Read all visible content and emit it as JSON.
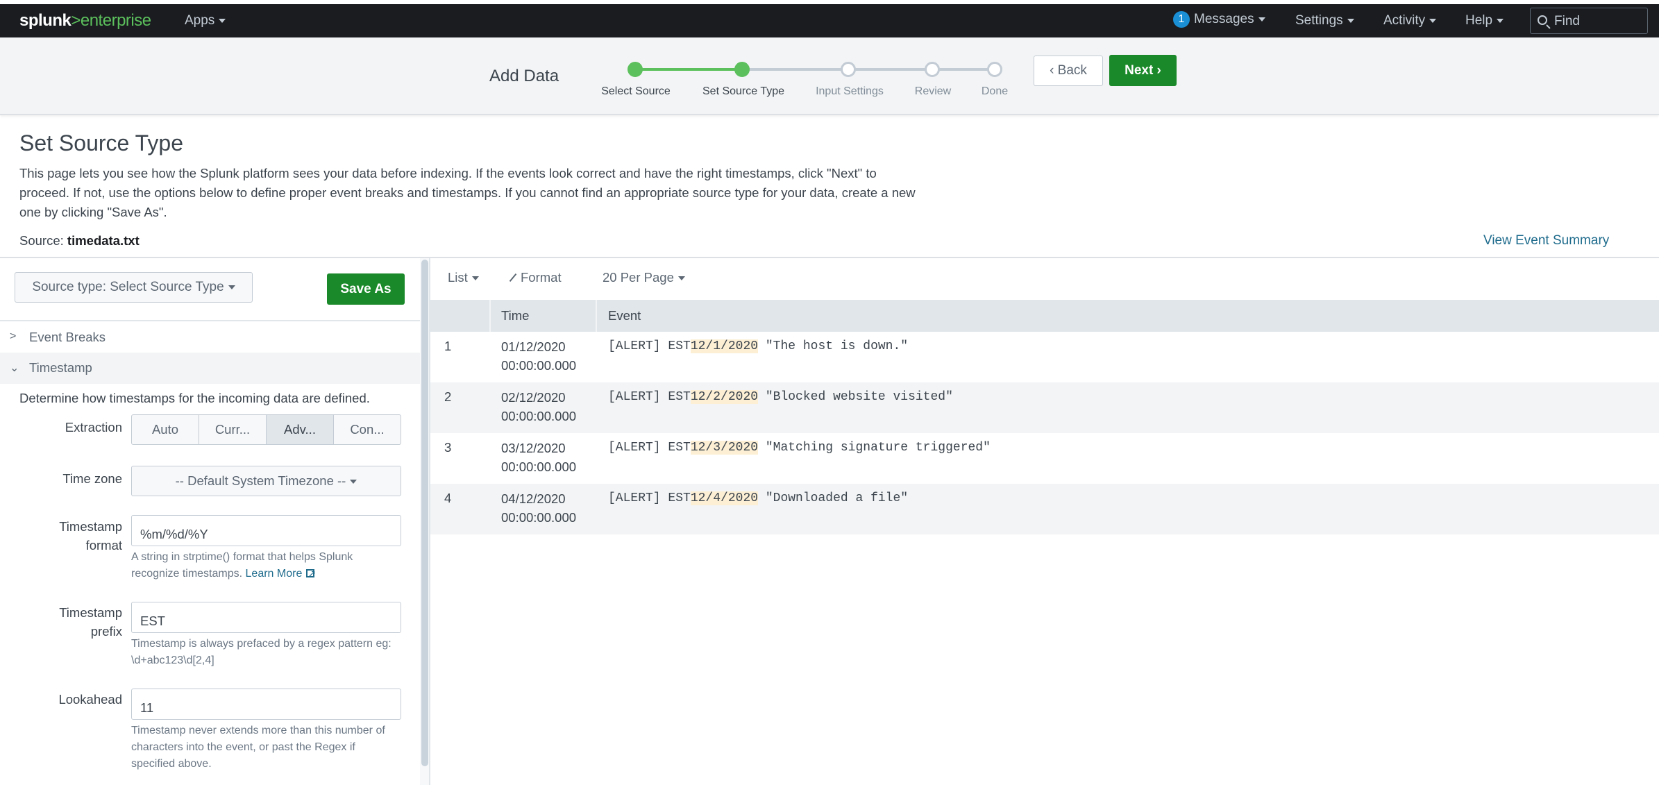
{
  "navbar": {
    "logo_brand": "splunk",
    "logo_separator": ">",
    "logo_product": "enterprise",
    "apps": "Apps",
    "messages_count": "1",
    "messages": "Messages",
    "settings": "Settings",
    "activity": "Activity",
    "help": "Help",
    "find_placeholder": "Find"
  },
  "wizard": {
    "title": "Add Data",
    "steps": [
      {
        "label": "Select Source",
        "status": "complete"
      },
      {
        "label": "Set Source Type",
        "status": "current"
      },
      {
        "label": "Input Settings",
        "status": "pending"
      },
      {
        "label": "Review",
        "status": "pending"
      },
      {
        "label": "Done",
        "status": "pending"
      }
    ],
    "back_label": "Back",
    "next_label": "Next"
  },
  "page": {
    "title": "Set Source Type",
    "description": "This page lets you see how the Splunk platform sees your data before indexing. If the events look correct and have the right timestamps, click \"Next\" to proceed. If not, use the options below to define proper event breaks and timestamps. If you cannot find an appropriate source type for your data, create a new one by clicking \"Save As\".",
    "source_label": "Source:",
    "source_value": "timedata.txt",
    "view_event_summary": "View Event Summary"
  },
  "left_panel": {
    "source_type_button": "Source type: Select Source Type",
    "save_as": "Save As",
    "sections": [
      {
        "label": "Event Breaks",
        "expanded": false
      },
      {
        "label": "Timestamp",
        "expanded": true
      }
    ],
    "timestamp": {
      "description": "Determine how timestamps for the incoming data are defined.",
      "extraction_label": "Extraction",
      "extraction_options": [
        "Auto",
        "Curr...",
        "Adv...",
        "Con..."
      ],
      "extraction_selected": "Adv...",
      "timezone_label": "Time zone",
      "timezone_value": "-- Default System Timezone --",
      "format_label_1": "Timestamp",
      "format_label_2": "format",
      "format_value": "%m/%d/%Y",
      "format_help": "A string in strptime() format that helps Splunk recognize timestamps.",
      "format_help_link": "Learn More",
      "prefix_label_1": "Timestamp",
      "prefix_label_2": "prefix",
      "prefix_value": "EST",
      "prefix_help": "Timestamp is always prefaced by a regex pattern eg: \\d+abc123\\d[2,4]",
      "lookahead_label": "Lookahead",
      "lookahead_value": "11",
      "lookahead_help": "Timestamp never extends more than this number of characters into the event, or past the Regex if specified above."
    }
  },
  "events": {
    "toolbar": {
      "list": "List",
      "format": "Format",
      "per_page": "20 Per Page"
    },
    "columns": [
      "",
      "Time",
      "Event"
    ],
    "rows": [
      {
        "num": "1",
        "date": "01/12/2020",
        "time": "00:00:00.000",
        "pre": "[ALERT] EST",
        "ts": "12/1/2020",
        "post": " \"The host is down.\""
      },
      {
        "num": "2",
        "date": "02/12/2020",
        "time": "00:00:00.000",
        "pre": "[ALERT] EST",
        "ts": "12/2/2020",
        "post": " \"Blocked website visited\""
      },
      {
        "num": "3",
        "date": "03/12/2020",
        "time": "00:00:00.000",
        "pre": "[ALERT] EST",
        "ts": "12/3/2020",
        "post": " \"Matching signature triggered\""
      },
      {
        "num": "4",
        "date": "04/12/2020",
        "time": "00:00:00.000",
        "pre": "[ALERT] EST",
        "ts": "12/4/2020",
        "post": " \"Downloaded a file\""
      }
    ]
  },
  "colors": {
    "nav_bg": "#1a1c20",
    "brand_green": "#5cc05c",
    "primary_button": "#1a8929",
    "link": "#1e6b8c",
    "badge": "#1a8fd5",
    "timestamp_highlight": "#fcefd4"
  }
}
